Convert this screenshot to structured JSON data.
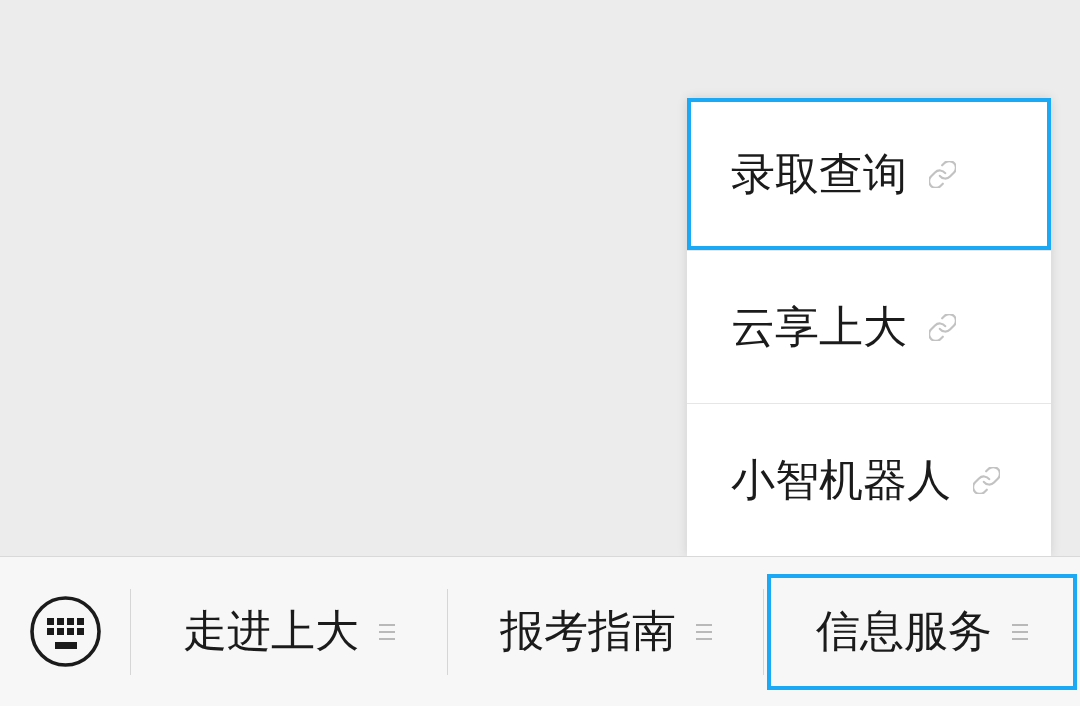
{
  "submenu": {
    "items": [
      {
        "label": "录取查询",
        "selected": true
      },
      {
        "label": "云享上大",
        "selected": false
      },
      {
        "label": "小智机器人",
        "selected": false
      }
    ]
  },
  "menu_bar": {
    "tabs": [
      {
        "label": "走进上大",
        "selected": false
      },
      {
        "label": "报考指南",
        "selected": false
      },
      {
        "label": "信息服务",
        "selected": true
      }
    ]
  }
}
